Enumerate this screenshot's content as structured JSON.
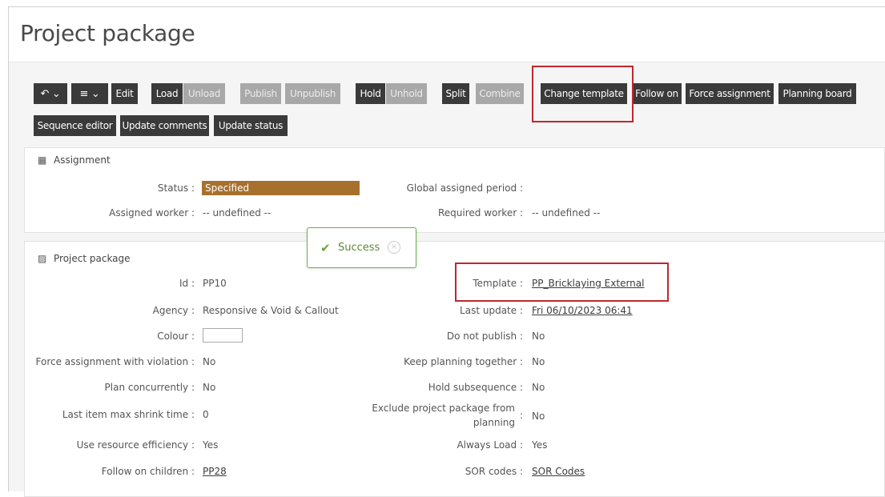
{
  "page": {
    "title": "Project package"
  },
  "toolbar": {
    "row1": [
      {
        "label": "↶ ⌄",
        "disabled": false
      },
      {
        "label": "≡ ⌄",
        "disabled": false
      },
      {
        "label": "Edit",
        "disabled": false
      },
      {
        "label": "Load",
        "disabled": false
      },
      {
        "label": "Unload",
        "disabled": true
      },
      {
        "label": "Publish",
        "disabled": true
      },
      {
        "label": "Unpublish",
        "disabled": true
      },
      {
        "label": "Hold",
        "disabled": false
      },
      {
        "label": "Unhold",
        "disabled": true
      },
      {
        "label": "Split",
        "disabled": false
      },
      {
        "label": "Combine",
        "disabled": true
      },
      {
        "label": "Change template",
        "disabled": false
      },
      {
        "label": "Follow on",
        "disabled": false
      },
      {
        "label": "Force assignment",
        "disabled": false
      },
      {
        "label": "Planning board",
        "disabled": false
      }
    ],
    "row2": [
      {
        "label": "Sequence editor",
        "disabled": false
      },
      {
        "label": "Update comments",
        "disabled": false
      },
      {
        "label": "Update status",
        "disabled": false
      }
    ]
  },
  "assignment": {
    "heading": "Assignment",
    "status_label": "Status :",
    "status_value": "Specified",
    "status_color": "#a7702d",
    "global_assigned_period_label": "Global assigned period :",
    "global_assigned_period_value": "",
    "assigned_worker_label": "Assigned worker :",
    "assigned_worker_value": "-- undefined --",
    "required_worker_label": "Required worker :",
    "required_worker_value": "-- undefined --"
  },
  "project_package": {
    "heading": "Project package",
    "left": [
      {
        "label": "Id :",
        "value": "PP10"
      },
      {
        "label": "Agency :",
        "value": "Responsive & Void & Callout"
      },
      {
        "label": "Colour :",
        "value": ""
      },
      {
        "label": "Force assignment with violation :",
        "value": "No"
      },
      {
        "label": "Plan concurrently :",
        "value": "No"
      },
      {
        "label": "Last item max shrink time :",
        "value": "0"
      },
      {
        "label": "Use resource efficiency :",
        "value": "Yes"
      },
      {
        "label": "Follow on children :",
        "value": "PP28"
      }
    ],
    "right": [
      {
        "label": "Template :",
        "value": "PP_Bricklaying External"
      },
      {
        "label": "Last update :",
        "value": "Fri 06/10/2023 06:41"
      },
      {
        "label": "Do not publish :",
        "value": "No"
      },
      {
        "label": "Keep planning together :",
        "value": "No"
      },
      {
        "label": "Hold subsequence :",
        "value": "No"
      },
      {
        "label": "Exclude project package from",
        "label2": "planning",
        "value": "No"
      },
      {
        "label": "Always Load :",
        "value": "Yes"
      },
      {
        "label": "SOR codes :",
        "value": "SOR Codes"
      }
    ]
  },
  "toast": {
    "message": "Success",
    "close_label": "×"
  }
}
